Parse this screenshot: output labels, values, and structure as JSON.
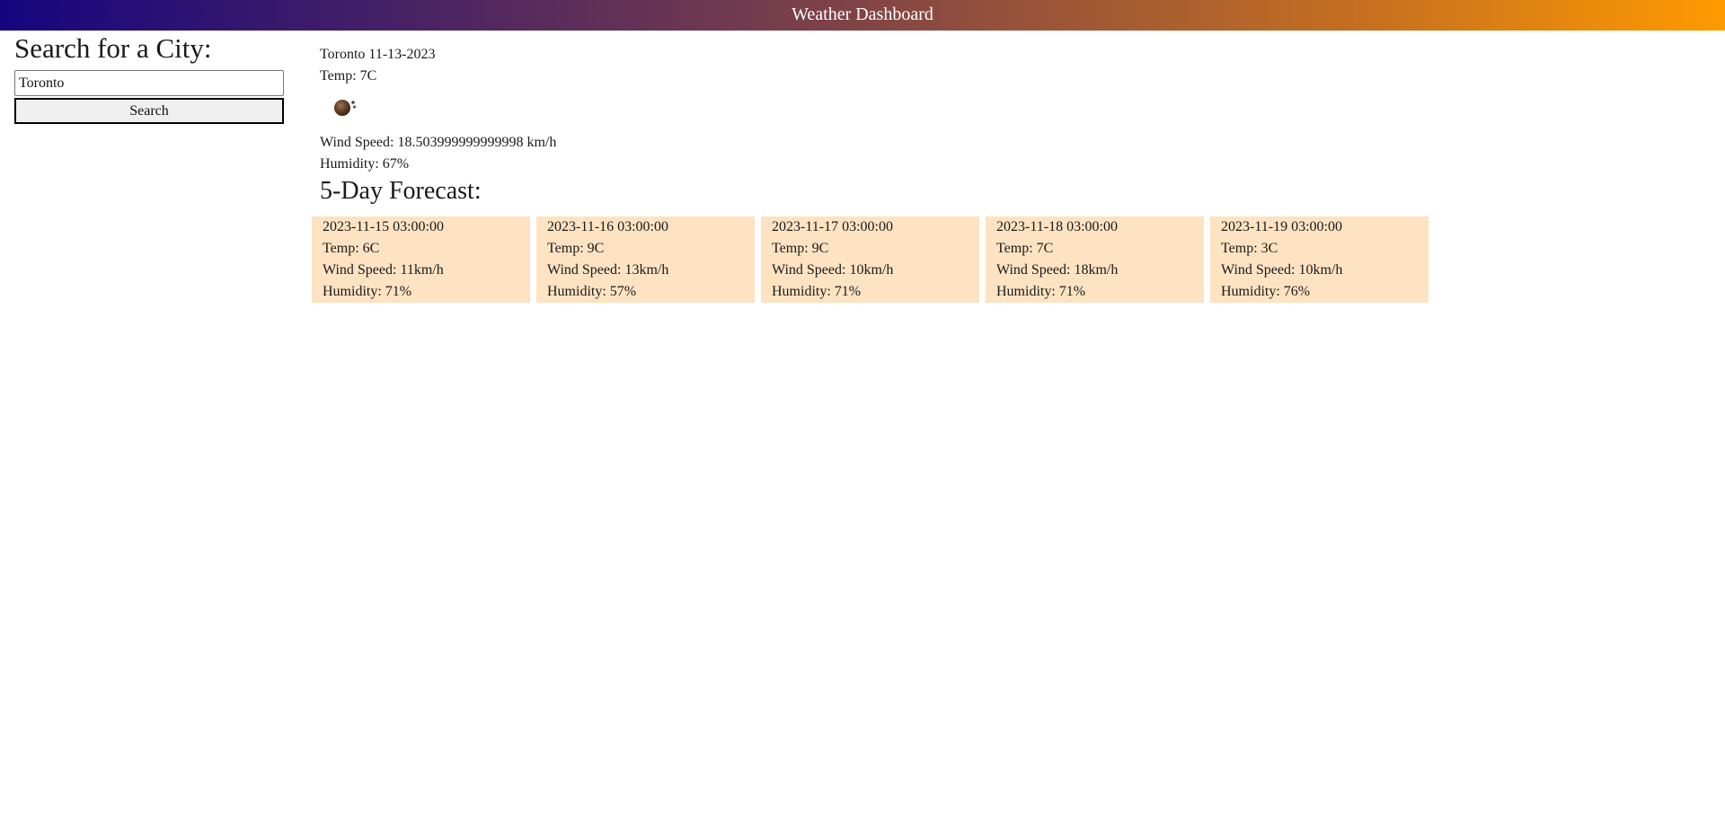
{
  "header": {
    "title": "Weather Dashboard"
  },
  "search": {
    "heading": "Search for a City:",
    "input_value": "Toronto",
    "button_label": "Search"
  },
  "current": {
    "title": "Toronto 11-13-2023",
    "temp": "Temp: 7C",
    "icon": "cloudy-weather-icon",
    "wind": "Wind Speed: 18.503999999999998 km/h",
    "humidity": "Humidity: 67%"
  },
  "forecast": {
    "heading": "5-Day Forecast:",
    "days": [
      {
        "date": "2023-11-15 03:00:00",
        "temp": "Temp: 6C",
        "wind": "Wind Speed: 11km/h",
        "humidity": "Humidity: 71%"
      },
      {
        "date": "2023-11-16 03:00:00",
        "temp": "Temp: 9C",
        "wind": "Wind Speed: 13km/h",
        "humidity": "Humidity: 57%"
      },
      {
        "date": "2023-11-17 03:00:00",
        "temp": "Temp: 9C",
        "wind": "Wind Speed: 10km/h",
        "humidity": "Humidity: 71%"
      },
      {
        "date": "2023-11-18 03:00:00",
        "temp": "Temp: 7C",
        "wind": "Wind Speed: 18km/h",
        "humidity": "Humidity: 71%"
      },
      {
        "date": "2023-11-19 03:00:00",
        "temp": "Temp: 3C",
        "wind": "Wind Speed: 10km/h",
        "humidity": "Humidity: 76%"
      }
    ]
  },
  "colors": {
    "header_gradient_start": "#15057f",
    "header_gradient_end": "#ff9a00",
    "card_background": "#fde3c2"
  }
}
